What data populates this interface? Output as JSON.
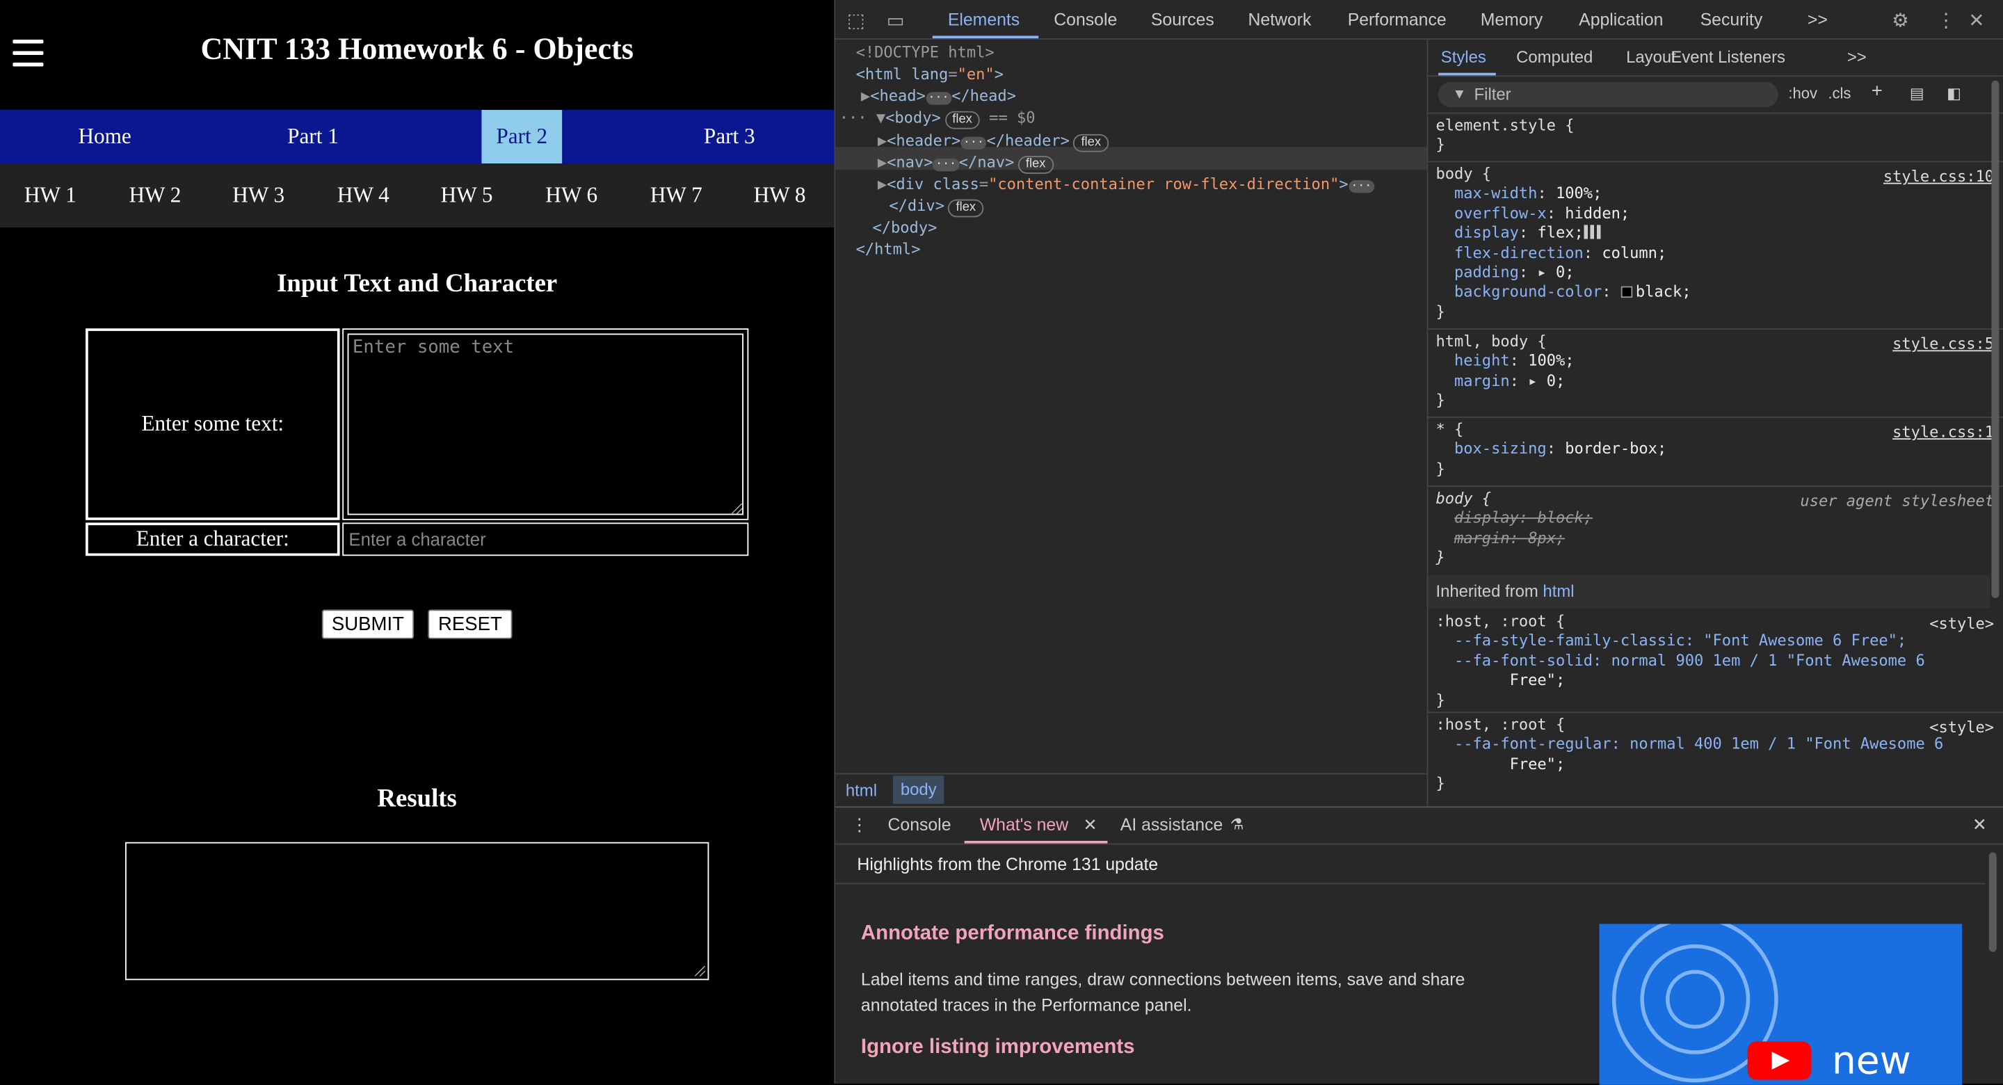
{
  "page": {
    "title": "CNIT 133 Homework 6 - Objects",
    "parts": [
      "Home",
      "Part 1",
      "Part 2",
      "Part 3"
    ],
    "active_part": "Part 2",
    "homeworks": [
      "HW 1",
      "HW 2",
      "HW 3",
      "HW 4",
      "HW 5",
      "HW 6",
      "HW 7",
      "HW 8"
    ],
    "section_title": "Input Text and Character",
    "text_label": "Enter some text:",
    "text_placeholder": "Enter some text",
    "char_label": "Enter a character:",
    "char_placeholder": "Enter a character",
    "submit_label": "SUBMIT",
    "reset_label": "RESET",
    "results_title": "Results"
  },
  "devtools": {
    "tabs": [
      "Elements",
      "Console",
      "Sources",
      "Network",
      "Performance",
      "Memory",
      "Application",
      "Security"
    ],
    "more_tabs": ">>",
    "active_tab": "Elements",
    "dom": {
      "doctype": "<!DOCTYPE html>",
      "html_open_tag": "<html",
      "html_attr": "lang",
      "html_attr_val": "\"en\"",
      "head": "<head>",
      "head_close": "</head>",
      "body": "<body>",
      "body_pill": "flex",
      "body_selected": "== $0",
      "header": "<header>",
      "header_close": "</header>",
      "header_pill": "flex",
      "nav": "<nav>",
      "nav_close": "</nav>",
      "nav_pill": "flex",
      "div_open": "<div",
      "div_attr": "class",
      "div_val": "\"content-container row-flex-direction\"",
      "div_close": "</div>",
      "div_pill": "flex",
      "body_close": "</body>",
      "html_close": "</html>"
    },
    "breadcrumbs": [
      "html",
      "body"
    ],
    "styles_tabs": [
      "Styles",
      "Computed",
      "Layout",
      "Event Listeners"
    ],
    "filter_placeholder": "Filter",
    "filter_tools": [
      ":hov",
      ".cls"
    ],
    "element_style": "element.style {",
    "rules": {
      "body_selector": "body {",
      "body_src": "style.css:10",
      "body_props": [
        {
          "p": "max-width",
          "v": "100%;"
        },
        {
          "p": "overflow-x",
          "v": "hidden;"
        },
        {
          "p": "display",
          "v": "flex;"
        },
        {
          "p": "flex-direction",
          "v": "column;"
        },
        {
          "p": "padding",
          "v": "0;"
        },
        {
          "p": "background-color",
          "v": "black;"
        }
      ],
      "htmlbody_selector": "html, body {",
      "htmlbody_src": "style.css:5",
      "htmlbody_props": [
        {
          "p": "height",
          "v": "100%;"
        },
        {
          "p": "margin",
          "v": "0;"
        }
      ],
      "star_selector": "* {",
      "star_src": "style.css:1",
      "star_props": [
        {
          "p": "box-sizing",
          "v": "border-box;"
        }
      ],
      "ua_selector": "body {",
      "ua_src": "user agent stylesheet",
      "ua_props": [
        "display: block;",
        "margin: 8px;"
      ],
      "inherited_label": "Inherited from",
      "inherited_from": "html",
      "host1_selector": ":host, :root {",
      "host_src": "<style>",
      "host1_lines": [
        "--fa-style-family-classic: \"Font Awesome 6 Free\";",
        "--fa-font-solid: normal 900 1em / 1 \"Font Awesome 6",
        "Free\";"
      ],
      "host2_selector": ":host, :root {",
      "host2_lines": [
        "--fa-font-regular: normal 400 1em / 1 \"Font Awesome 6",
        "Free\";"
      ],
      "close": "}"
    },
    "drawer": {
      "tabs": [
        "Console",
        "What's new",
        "AI assistance"
      ],
      "active_tab": "What's new",
      "subtitle": "Highlights from the Chrome 131 update",
      "heading1": "Annotate performance findings",
      "body1": "Label items and time ranges, draw connections between items, save and share annotated traces in the Performance panel.",
      "heading2": "Ignore listing improvements",
      "thumb_text": "new"
    },
    "colors": {
      "accent": "#8ab4f8",
      "whats_new": "#f3a4b8",
      "nav_blue": "#0b1790",
      "active_part": "#8fcbea"
    }
  }
}
